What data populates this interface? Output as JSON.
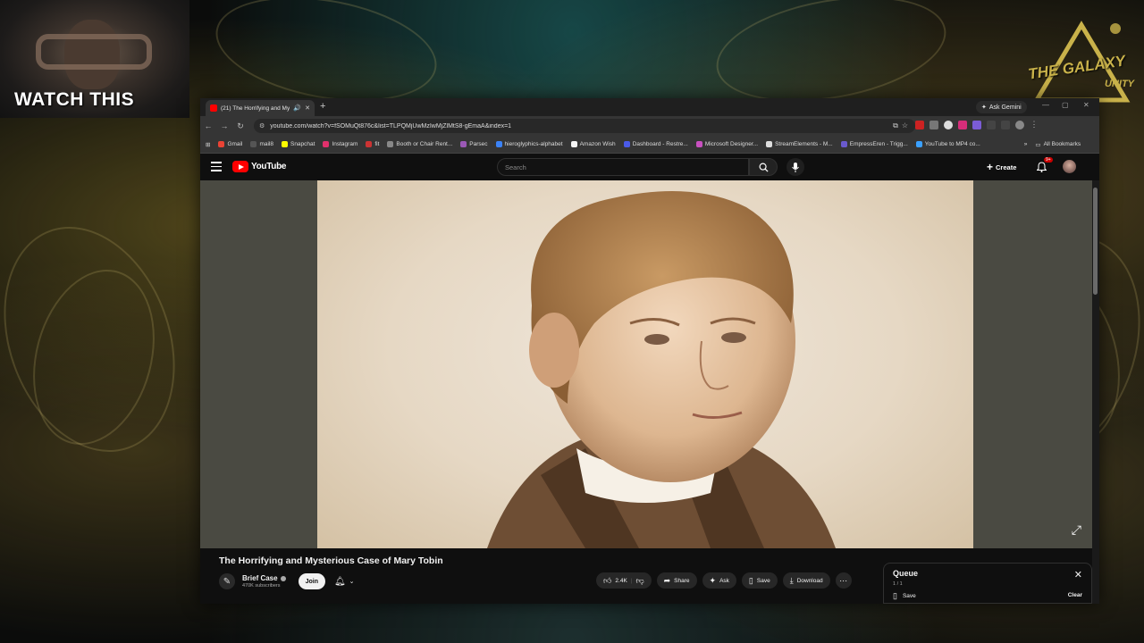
{
  "overlay": {
    "watch_label": "WATCH THIS",
    "galaxy_logo_text": "THE GALAXY",
    "galaxy_logo_sub": "UNITY"
  },
  "browser": {
    "tab": {
      "title": "(21) The Horrifying and My",
      "icon": "speaker-icon"
    },
    "ask_gemini": "Ask Gemini",
    "url": "youtube.com/watch?v=fSOMuQt876c&list=TLPQMjUwMzIwMjZlMtS8-gEmaA&index=1",
    "bookmarks": [
      {
        "label": "Gmail",
        "color": "#ea4335"
      },
      {
        "label": "mail8",
        "color": "#555555"
      },
      {
        "label": "Snapchat",
        "color": "#fffc00"
      },
      {
        "label": "Instagram",
        "color": "#e1306c"
      },
      {
        "label": "fit",
        "color": "#cc3333"
      },
      {
        "label": "Booth or Chair Rent...",
        "color": "#888888"
      },
      {
        "label": "Parsec",
        "color": "#9b59b6"
      },
      {
        "label": "hieroglyphics-alphabet",
        "color": "#3b82f6"
      },
      {
        "label": "Amazon Wish",
        "color": "#f5f5f5"
      },
      {
        "label": "Dashboard - Restre...",
        "color": "#4a5ae8"
      },
      {
        "label": "Microsoft Designer...",
        "color": "#c850c0"
      },
      {
        "label": "StreamElements - M...",
        "color": "#dddddd"
      },
      {
        "label": "EmpressEren - Trigg...",
        "color": "#6a5acd"
      },
      {
        "label": "YouTube to MP4 co...",
        "color": "#3aa0ff"
      }
    ],
    "all_bookmarks": "All Bookmarks"
  },
  "youtube": {
    "logo_text": "YouTube",
    "search_placeholder": "Search",
    "create_label": "Create",
    "notification_badge": "9+",
    "video": {
      "title": "The Horrifying and Mysterious Case of Mary Tobin"
    },
    "channel": {
      "name": "Brief Case",
      "subscribers": "470K subscribers",
      "join_label": "Join"
    },
    "actions": {
      "like_count": "2.4K",
      "share_label": "Share",
      "ask_label": "Ask",
      "save_label": "Save",
      "download_label": "Download"
    },
    "queue": {
      "title": "Queue",
      "count": "1 / 1",
      "save_label": "Save",
      "clear_label": "Clear"
    }
  }
}
